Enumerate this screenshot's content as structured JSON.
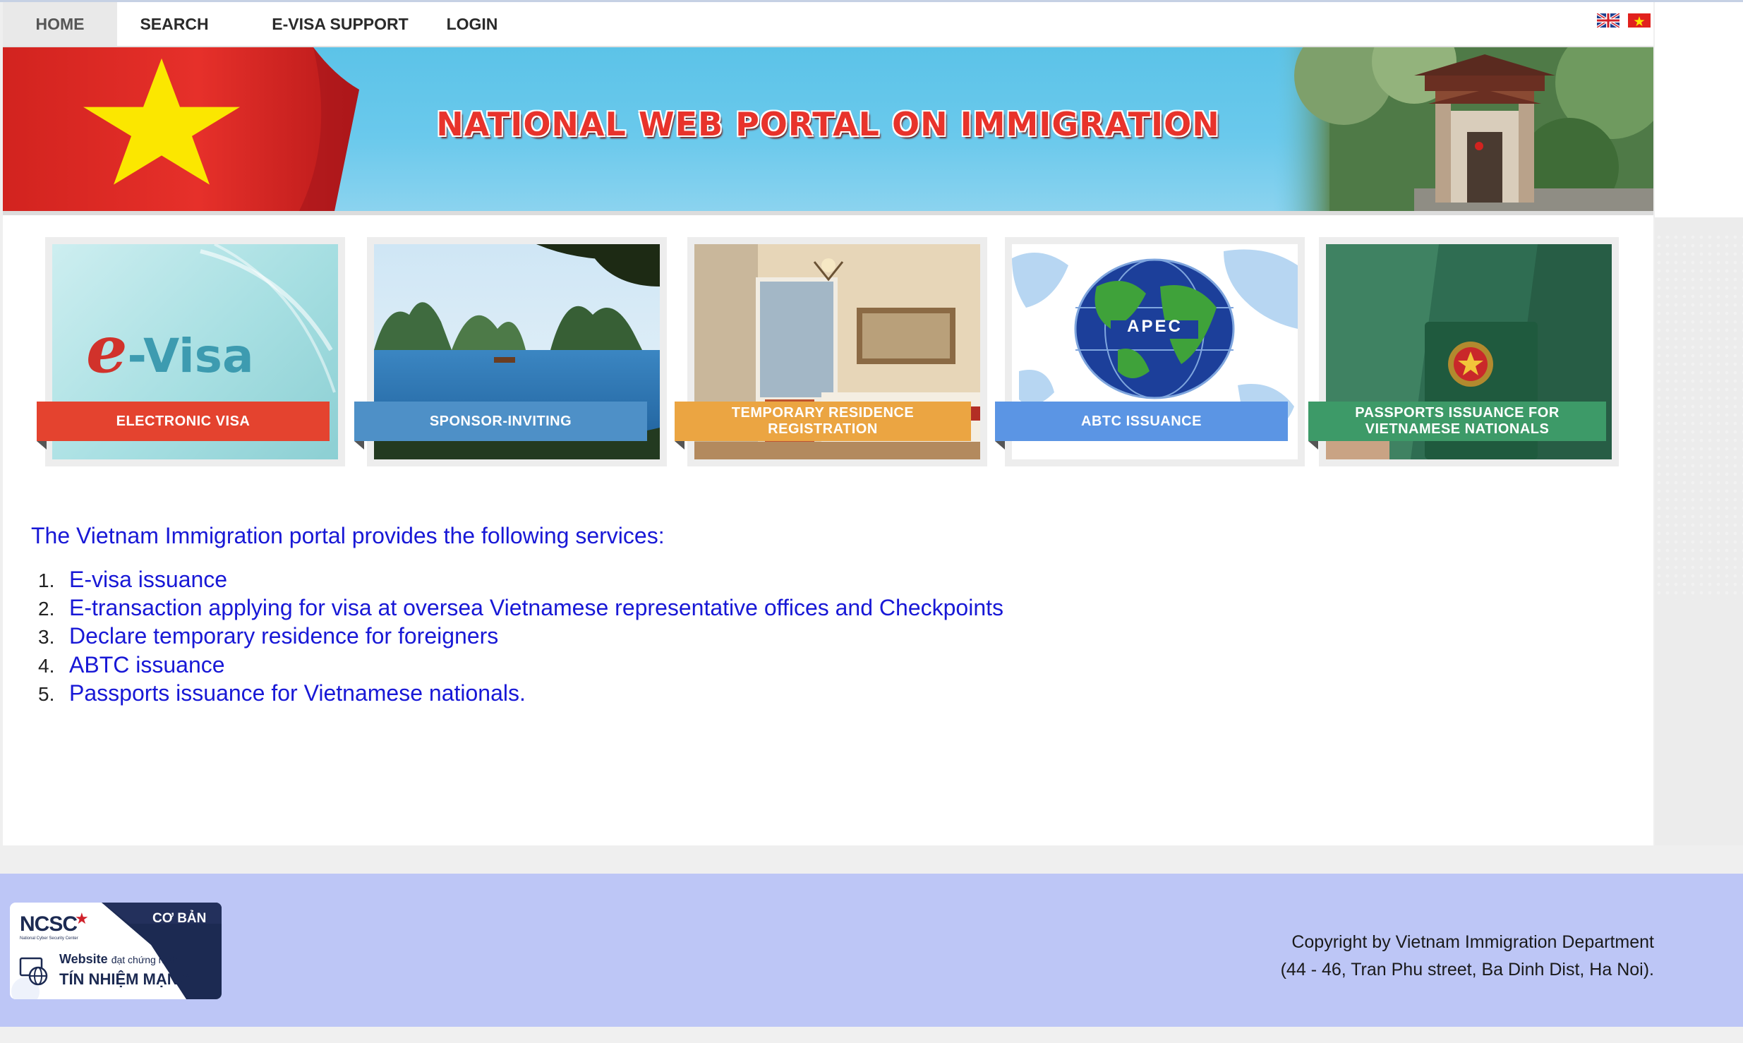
{
  "nav": {
    "items": [
      {
        "label": "HOME"
      },
      {
        "label": "SEARCH"
      },
      {
        "label": "E-VISA SUPPORT"
      },
      {
        "label": "LOGIN"
      }
    ]
  },
  "banner": {
    "title": "NATIONAL WEB PORTAL ON IMMIGRATION"
  },
  "tiles": [
    {
      "label": "ELECTRONIC VISA",
      "logo_text": "e-Visa",
      "color": "#e4432f"
    },
    {
      "label": "SPONSOR-INVITING",
      "color": "#4e90c7"
    },
    {
      "label": "TEMPORARY RESIDENCE REGISTRATION",
      "color": "#eba542"
    },
    {
      "label": "ABTC ISSUANCE",
      "logo_text": "APEC",
      "color": "#5b95e4"
    },
    {
      "label": "PASSPORTS ISSUANCE FOR VIETNAMESE NATIONALS",
      "color": "#3d9a68"
    }
  ],
  "content": {
    "intro": "The Vietnam Immigration portal provides the following services:",
    "services": [
      {
        "num": "1.",
        "text": "E-visa issuance"
      },
      {
        "num": "2.",
        "text": "E-transaction applying for visa at oversea Vietnamese representative offices and Checkpoints"
      },
      {
        "num": "3.",
        "text": "Declare temporary residence for foreigners"
      },
      {
        "num": "4.",
        "text": "ABTC issuance"
      },
      {
        "num": "5.",
        "text": "Passports issuance for Vietnamese nationals."
      }
    ]
  },
  "footer": {
    "badge": {
      "org": "NCSC",
      "sub": "National Cyber Security Center",
      "level": "CƠ BẢN",
      "line1a": "Website",
      "line1b": "đạt chứng nhận",
      "line2": "TÍN NHIỆM MẠNG"
    },
    "copyright_line1": "Copyright by Vietnam Immigration Department",
    "copyright_line2": "(44 - 46, Tran Phu street, Ba Dinh Dist, Ha Noi)."
  },
  "colors": {
    "link": "#1818d6",
    "footer_bg": "#bdc6f6",
    "flag_red": "#e1211d",
    "star_yellow": "#fbe700"
  }
}
